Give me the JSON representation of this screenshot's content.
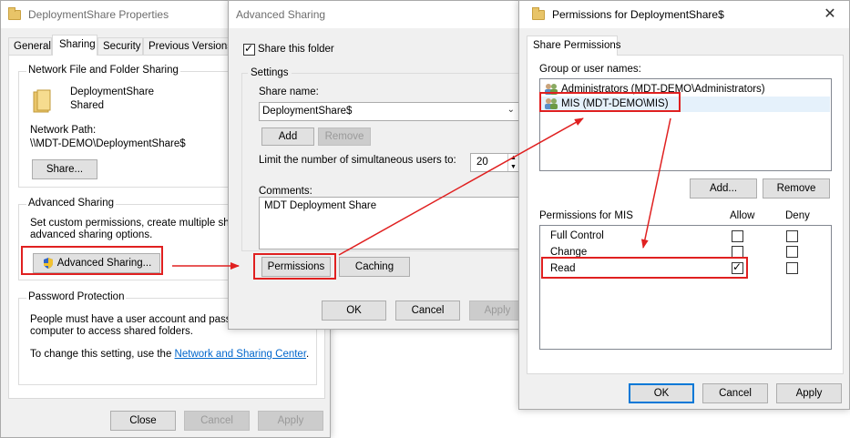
{
  "props": {
    "title": "DeploymentShare Properties",
    "tabs": [
      "General",
      "Sharing",
      "Security",
      "Previous Versions"
    ],
    "nffs_label": "Network File and Folder Sharing",
    "share_name": "DeploymentShare",
    "share_state": "Shared",
    "network_path_label": "Network Path:",
    "network_path": "\\\\MDT-DEMO\\DeploymentShare$",
    "share_button": "Share...",
    "adv_label": "Advanced Sharing",
    "adv_desc1": "Set custom permissions, create multiple shares,",
    "adv_desc2": "advanced sharing options.",
    "adv_button": "Advanced Sharing...",
    "pw_label": "Password Protection",
    "pw_desc1": "People must have a user account and passwor",
    "pw_desc2": "computer to access shared folders.",
    "pw_change_prefix": "To change this setting, use the ",
    "pw_change_link": "Network and Sharing Center",
    "pw_change_suffix": ".",
    "close": "Close",
    "cancel": "Cancel",
    "apply": "Apply"
  },
  "adv": {
    "title": "Advanced Sharing",
    "share_this_folder": "Share this folder",
    "settings_label": "Settings",
    "share_name_label": "Share name:",
    "share_name_value": "DeploymentShare$",
    "add": "Add",
    "remove": "Remove",
    "limit_label": "Limit the number of simultaneous users to:",
    "limit_value": "20",
    "comments_label": "Comments:",
    "comments_value": "MDT Deployment Share",
    "permissions": "Permissions",
    "caching": "Caching",
    "ok": "OK",
    "cancel": "Cancel",
    "apply": "Apply"
  },
  "perm": {
    "title": "Permissions for DeploymentShare$",
    "tab": "Share Permissions",
    "group_label": "Group or user names:",
    "users": [
      "Administrators (MDT-DEMO\\Administrators)",
      "MIS (MDT-DEMO\\MIS)"
    ],
    "add": "Add...",
    "remove": "Remove",
    "perms_for": "Permissions for MIS",
    "allow": "Allow",
    "deny": "Deny",
    "rows": [
      {
        "name": "Full Control",
        "allow": false,
        "deny": false
      },
      {
        "name": "Change",
        "allow": false,
        "deny": false
      },
      {
        "name": "Read",
        "allow": true,
        "deny": false
      }
    ],
    "ok": "OK",
    "cancel": "Cancel",
    "apply": "Apply"
  },
  "colors": {
    "annotation_red": "#e02020",
    "selection": "#cce8ff",
    "link": "#0066cc"
  }
}
